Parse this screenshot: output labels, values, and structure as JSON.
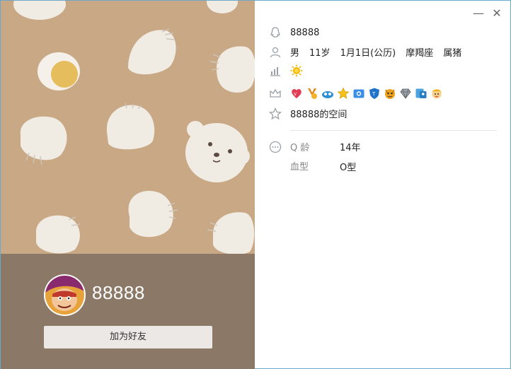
{
  "window": {
    "minimize_glyph": "—",
    "close_glyph": "✕"
  },
  "profile": {
    "qq_number": "88888",
    "nickname": "88888",
    "gender": "男",
    "age": "11岁",
    "birthday": "1月1日(公历)",
    "zodiac": "摩羯座",
    "chinese_zodiac": "属猪",
    "space_link": "88888的空间",
    "add_friend_label": "加为好友"
  },
  "details": {
    "q_age_label": "Q 龄",
    "q_age_value": "14年",
    "blood_type_label": "血型",
    "blood_type_value": "O型"
  },
  "icons": {
    "qq": "qq-penguin-icon",
    "person": "person-icon",
    "level": "level-chart-icon",
    "vip": "crown-icon",
    "space": "star-icon",
    "more": "ellipsis-circle-icon",
    "level_badge": "sun-icon"
  },
  "badges": [
    "heart-badge",
    "vip-badge",
    "weiyun-badge",
    "star-badge",
    "photo-badge",
    "shield-badge",
    "pet-badge",
    "diamond-badge",
    "id-badge",
    "kid-badge"
  ],
  "colors": {
    "wallpaper": "#c8a885",
    "bottom_card": "#8b7867",
    "window_border": "#6aa7c8"
  }
}
